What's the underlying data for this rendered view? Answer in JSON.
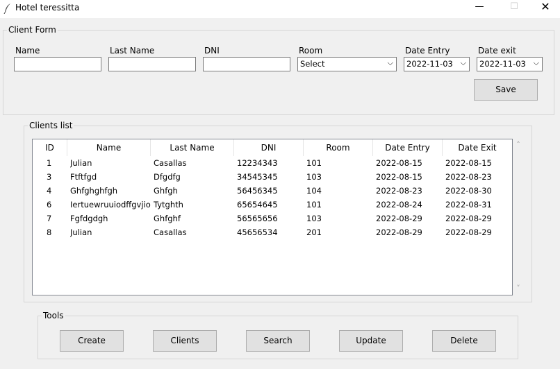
{
  "window": {
    "title": "Hotel teressitta",
    "minimize": "—",
    "maximize": "☐",
    "close": "✕"
  },
  "client_form": {
    "legend": "Client Form",
    "name_label": "Name",
    "last_name_label": "Last Name",
    "dni_label": "DNI",
    "room_label": "Room",
    "room_value": "Select",
    "date_entry_label": "Date Entry",
    "date_entry_value": "2022-11-03",
    "date_exit_label": "Date exit",
    "date_exit_value": "2022-11-03",
    "save_label": "Save",
    "chevron": "⌵"
  },
  "clients_list": {
    "legend": "Clients list",
    "columns": [
      "ID",
      "Name",
      "Last Name",
      "DNI",
      "Room",
      "Date Entry",
      "Date Exit"
    ],
    "rows": [
      [
        "1",
        "Julian",
        "Casallas",
        "12234343",
        "101",
        "2022-08-15",
        "2022-08-15"
      ],
      [
        "3",
        "Ftftfgd",
        "Dfgdfg",
        "34545345",
        "103",
        "2022-08-15",
        "2022-08-23"
      ],
      [
        "4",
        "Ghfghghfgh",
        "Ghfgh",
        "56456345",
        "104",
        "2022-08-23",
        "2022-08-30"
      ],
      [
        "6",
        "Iertuewruuiodffgvjio",
        "Tytghth",
        "65654645",
        "101",
        "2022-08-24",
        "2022-08-31"
      ],
      [
        "7",
        "Fgfdgdgh",
        "Ghfghf",
        "56565656",
        "103",
        "2022-08-29",
        "2022-08-29"
      ],
      [
        "8",
        "Julian",
        "Casallas",
        "45656534",
        "201",
        "2022-08-29",
        "2022-08-29"
      ]
    ],
    "scroll_up": "˄",
    "scroll_down": "˅"
  },
  "tools": {
    "legend": "Tools",
    "create_label": "Create",
    "clients_label": "Clients",
    "search_label": "Search",
    "update_label": "Update",
    "delete_label": "Delete"
  }
}
